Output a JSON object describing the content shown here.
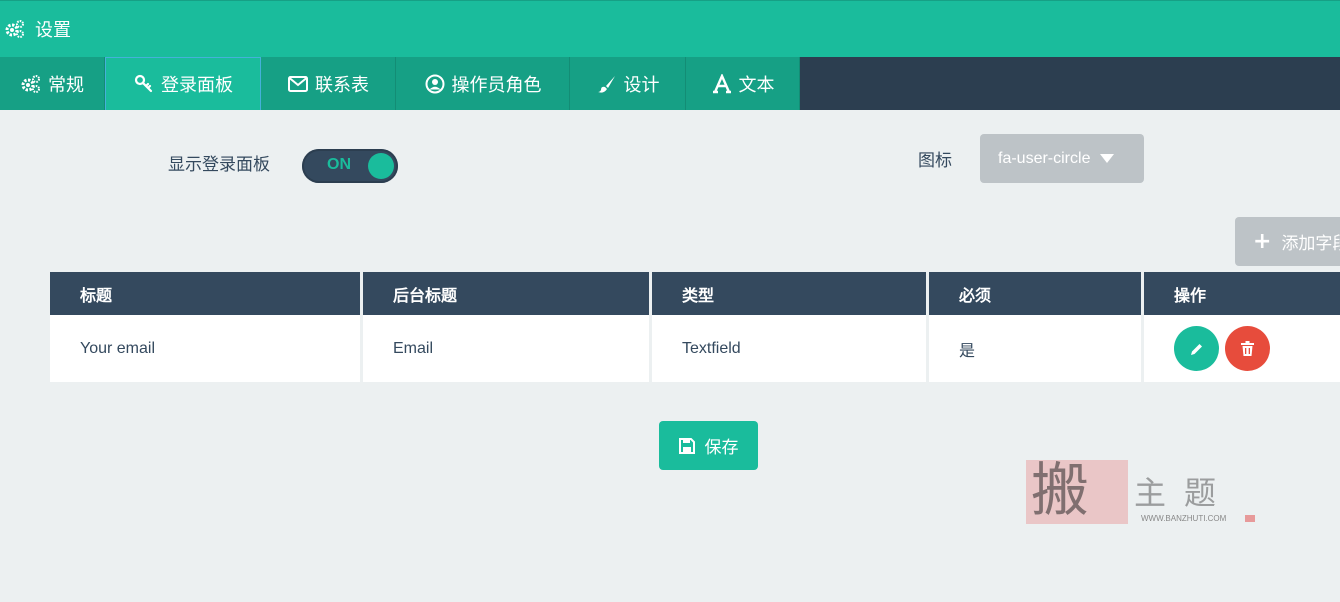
{
  "header": {
    "title": "设置",
    "icon": "gears-icon"
  },
  "tabs": [
    {
      "label": "常规",
      "icon": "gears-icon",
      "active": false
    },
    {
      "label": "登录面板",
      "icon": "key-icon",
      "active": true
    },
    {
      "label": "联系表",
      "icon": "envelope-icon",
      "active": false
    },
    {
      "label": "操作员角色",
      "icon": "user-circle-icon",
      "active": false
    },
    {
      "label": "设计",
      "icon": "paint-brush-icon",
      "active": false
    },
    {
      "label": "文本",
      "icon": "font-icon",
      "active": false
    }
  ],
  "login_panel": {
    "show_label": "显示登录面板",
    "toggle_state": "ON",
    "icon_label": "图标",
    "icon_value": "fa-user-circle",
    "add_field_label": "添加字段"
  },
  "fields_table": {
    "columns": [
      "标题",
      "后台标题",
      "类型",
      "必须",
      "操作"
    ],
    "rows": [
      {
        "title": "Your email",
        "backend_title": "Email",
        "type": "Textfield",
        "required": "是"
      }
    ]
  },
  "save_label": "保存",
  "watermark": {
    "big": "搬",
    "small": "主题",
    "url": "WWW.BANZHUTI.COM"
  },
  "colors": {
    "primary": "#1abc9c",
    "dark": "#34495e",
    "danger": "#e74c3c",
    "muted": "#bdc3c7",
    "background": "#ecf0f1"
  }
}
